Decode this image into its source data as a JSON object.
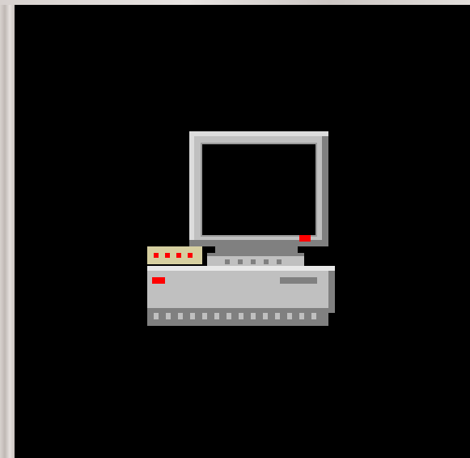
{
  "screen": {
    "icon": "pixel-computer-icon"
  },
  "colors": {
    "background": "#000000",
    "frame": "#cfc8c4",
    "monitor_light": "#c0c0c0",
    "monitor_dark": "#808080",
    "indicator": "#ff0000",
    "modem": "#d6cfa0"
  }
}
